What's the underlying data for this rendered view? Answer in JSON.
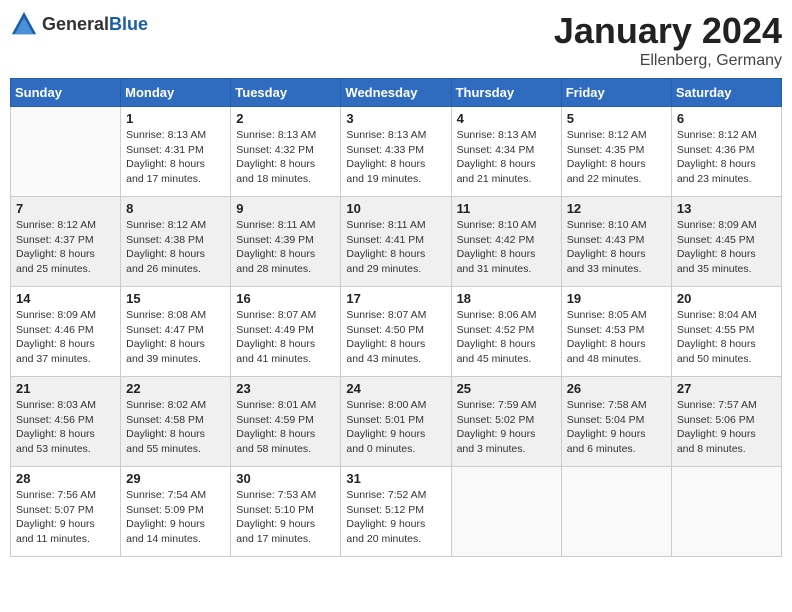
{
  "header": {
    "logo_general": "General",
    "logo_blue": "Blue",
    "month_title": "January 2024",
    "location": "Ellenberg, Germany"
  },
  "days_of_week": [
    "Sunday",
    "Monday",
    "Tuesday",
    "Wednesday",
    "Thursday",
    "Friday",
    "Saturday"
  ],
  "weeks": [
    [
      {
        "day": "",
        "sunrise": "",
        "sunset": "",
        "daylight": ""
      },
      {
        "day": "1",
        "sunrise": "Sunrise: 8:13 AM",
        "sunset": "Sunset: 4:31 PM",
        "daylight": "Daylight: 8 hours and 17 minutes."
      },
      {
        "day": "2",
        "sunrise": "Sunrise: 8:13 AM",
        "sunset": "Sunset: 4:32 PM",
        "daylight": "Daylight: 8 hours and 18 minutes."
      },
      {
        "day": "3",
        "sunrise": "Sunrise: 8:13 AM",
        "sunset": "Sunset: 4:33 PM",
        "daylight": "Daylight: 8 hours and 19 minutes."
      },
      {
        "day": "4",
        "sunrise": "Sunrise: 8:13 AM",
        "sunset": "Sunset: 4:34 PM",
        "daylight": "Daylight: 8 hours and 21 minutes."
      },
      {
        "day": "5",
        "sunrise": "Sunrise: 8:12 AM",
        "sunset": "Sunset: 4:35 PM",
        "daylight": "Daylight: 8 hours and 22 minutes."
      },
      {
        "day": "6",
        "sunrise": "Sunrise: 8:12 AM",
        "sunset": "Sunset: 4:36 PM",
        "daylight": "Daylight: 8 hours and 23 minutes."
      }
    ],
    [
      {
        "day": "7",
        "sunrise": "Sunrise: 8:12 AM",
        "sunset": "Sunset: 4:37 PM",
        "daylight": "Daylight: 8 hours and 25 minutes."
      },
      {
        "day": "8",
        "sunrise": "Sunrise: 8:12 AM",
        "sunset": "Sunset: 4:38 PM",
        "daylight": "Daylight: 8 hours and 26 minutes."
      },
      {
        "day": "9",
        "sunrise": "Sunrise: 8:11 AM",
        "sunset": "Sunset: 4:39 PM",
        "daylight": "Daylight: 8 hours and 28 minutes."
      },
      {
        "day": "10",
        "sunrise": "Sunrise: 8:11 AM",
        "sunset": "Sunset: 4:41 PM",
        "daylight": "Daylight: 8 hours and 29 minutes."
      },
      {
        "day": "11",
        "sunrise": "Sunrise: 8:10 AM",
        "sunset": "Sunset: 4:42 PM",
        "daylight": "Daylight: 8 hours and 31 minutes."
      },
      {
        "day": "12",
        "sunrise": "Sunrise: 8:10 AM",
        "sunset": "Sunset: 4:43 PM",
        "daylight": "Daylight: 8 hours and 33 minutes."
      },
      {
        "day": "13",
        "sunrise": "Sunrise: 8:09 AM",
        "sunset": "Sunset: 4:45 PM",
        "daylight": "Daylight: 8 hours and 35 minutes."
      }
    ],
    [
      {
        "day": "14",
        "sunrise": "Sunrise: 8:09 AM",
        "sunset": "Sunset: 4:46 PM",
        "daylight": "Daylight: 8 hours and 37 minutes."
      },
      {
        "day": "15",
        "sunrise": "Sunrise: 8:08 AM",
        "sunset": "Sunset: 4:47 PM",
        "daylight": "Daylight: 8 hours and 39 minutes."
      },
      {
        "day": "16",
        "sunrise": "Sunrise: 8:07 AM",
        "sunset": "Sunset: 4:49 PM",
        "daylight": "Daylight: 8 hours and 41 minutes."
      },
      {
        "day": "17",
        "sunrise": "Sunrise: 8:07 AM",
        "sunset": "Sunset: 4:50 PM",
        "daylight": "Daylight: 8 hours and 43 minutes."
      },
      {
        "day": "18",
        "sunrise": "Sunrise: 8:06 AM",
        "sunset": "Sunset: 4:52 PM",
        "daylight": "Daylight: 8 hours and 45 minutes."
      },
      {
        "day": "19",
        "sunrise": "Sunrise: 8:05 AM",
        "sunset": "Sunset: 4:53 PM",
        "daylight": "Daylight: 8 hours and 48 minutes."
      },
      {
        "day": "20",
        "sunrise": "Sunrise: 8:04 AM",
        "sunset": "Sunset: 4:55 PM",
        "daylight": "Daylight: 8 hours and 50 minutes."
      }
    ],
    [
      {
        "day": "21",
        "sunrise": "Sunrise: 8:03 AM",
        "sunset": "Sunset: 4:56 PM",
        "daylight": "Daylight: 8 hours and 53 minutes."
      },
      {
        "day": "22",
        "sunrise": "Sunrise: 8:02 AM",
        "sunset": "Sunset: 4:58 PM",
        "daylight": "Daylight: 8 hours and 55 minutes."
      },
      {
        "day": "23",
        "sunrise": "Sunrise: 8:01 AM",
        "sunset": "Sunset: 4:59 PM",
        "daylight": "Daylight: 8 hours and 58 minutes."
      },
      {
        "day": "24",
        "sunrise": "Sunrise: 8:00 AM",
        "sunset": "Sunset: 5:01 PM",
        "daylight": "Daylight: 9 hours and 0 minutes."
      },
      {
        "day": "25",
        "sunrise": "Sunrise: 7:59 AM",
        "sunset": "Sunset: 5:02 PM",
        "daylight": "Daylight: 9 hours and 3 minutes."
      },
      {
        "day": "26",
        "sunrise": "Sunrise: 7:58 AM",
        "sunset": "Sunset: 5:04 PM",
        "daylight": "Daylight: 9 hours and 6 minutes."
      },
      {
        "day": "27",
        "sunrise": "Sunrise: 7:57 AM",
        "sunset": "Sunset: 5:06 PM",
        "daylight": "Daylight: 9 hours and 8 minutes."
      }
    ],
    [
      {
        "day": "28",
        "sunrise": "Sunrise: 7:56 AM",
        "sunset": "Sunset: 5:07 PM",
        "daylight": "Daylight: 9 hours and 11 minutes."
      },
      {
        "day": "29",
        "sunrise": "Sunrise: 7:54 AM",
        "sunset": "Sunset: 5:09 PM",
        "daylight": "Daylight: 9 hours and 14 minutes."
      },
      {
        "day": "30",
        "sunrise": "Sunrise: 7:53 AM",
        "sunset": "Sunset: 5:10 PM",
        "daylight": "Daylight: 9 hours and 17 minutes."
      },
      {
        "day": "31",
        "sunrise": "Sunrise: 7:52 AM",
        "sunset": "Sunset: 5:12 PM",
        "daylight": "Daylight: 9 hours and 20 minutes."
      },
      {
        "day": "",
        "sunrise": "",
        "sunset": "",
        "daylight": ""
      },
      {
        "day": "",
        "sunrise": "",
        "sunset": "",
        "daylight": ""
      },
      {
        "day": "",
        "sunrise": "",
        "sunset": "",
        "daylight": ""
      }
    ]
  ]
}
